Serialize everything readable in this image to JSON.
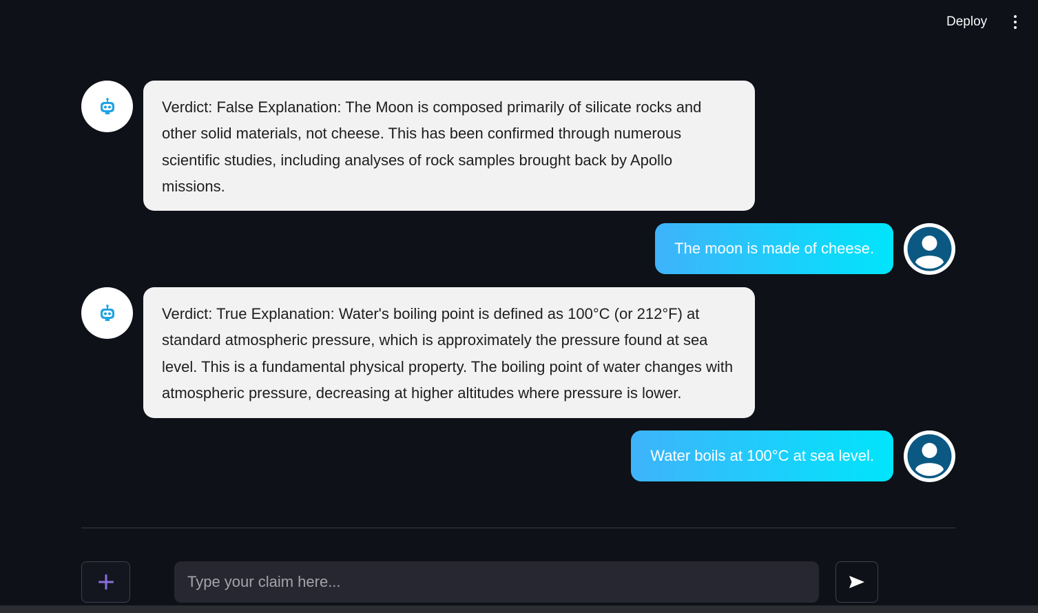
{
  "header": {
    "deploy_label": "Deploy",
    "menu_icon": "more-vertical-icon"
  },
  "chat": {
    "bot_avatar_icon": "robot-icon",
    "user_avatar_icon": "user-avatar-icon",
    "messages": [
      {
        "role": "assistant",
        "text": "Verdict: False Explanation: The Moon is composed primarily of silicate rocks and other solid materials, not cheese. This has been confirmed through numerous scientific studies, including analyses of rock samples brought back by Apollo missions."
      },
      {
        "role": "user",
        "text": "The moon is made of cheese."
      },
      {
        "role": "assistant",
        "text": "Verdict: True Explanation: Water's boiling point is defined as 100°C (or 212°F) at standard atmospheric pressure, which is approximately the pressure found at sea level. This is a fundamental physical property. The boiling point of water changes with atmospheric pressure, decreasing at higher altitudes where pressure is lower."
      },
      {
        "role": "user",
        "text": "Water boils at 100°C at sea level."
      }
    ]
  },
  "input": {
    "placeholder": "Type your claim here...",
    "value": "",
    "add_icon": "plus-icon",
    "send_icon": "send-icon"
  },
  "colors": {
    "background": "#0e1117",
    "bot_bubble": "#f2f2f2",
    "user_bubble_start": "#3fb3fb",
    "user_bubble_end": "#00e5fb",
    "robot_accent": "#1fa3e3",
    "user_avatar": "#0b5983",
    "plus_accent": "#8b6fe0"
  }
}
